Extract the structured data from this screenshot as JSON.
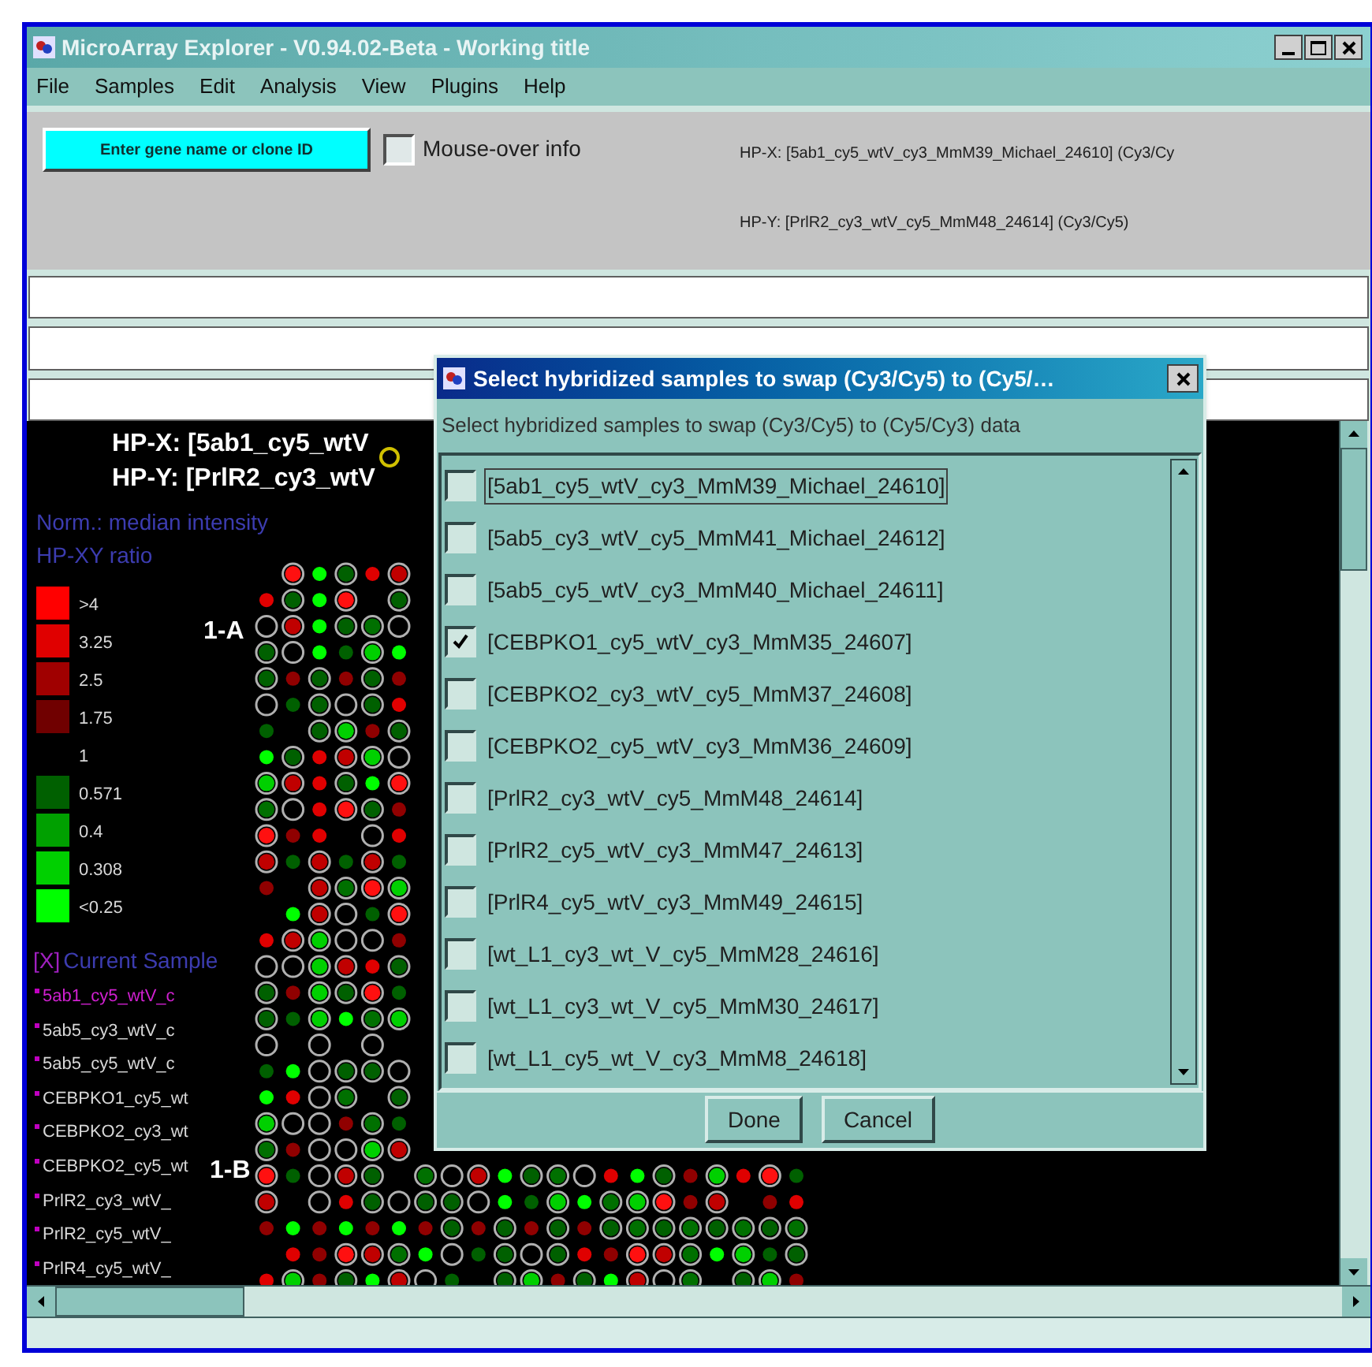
{
  "window": {
    "title": "MicroArray Explorer - V0.94.02-Beta - Working title"
  },
  "menu": [
    "File",
    "Samples",
    "Edit",
    "Analysis",
    "View",
    "Plugins",
    "Help"
  ],
  "toolbar": {
    "search_button": "Enter gene name or clone ID",
    "mouse_over": {
      "label": "Mouse-over info",
      "checked": false
    },
    "hp_x": "HP-X: [5ab1_cy5_wtV_cy3_MmM39_Michael_24610] (Cy3/Cy",
    "hp_y": "HP-Y: [PrlR2_cy3_wtV_cy5_MmM48_24614] (Cy3/Cy5)"
  },
  "canvas": {
    "hp_x": "HP-X: [5ab1_cy5_wtV",
    "hp_y": "HP-Y: [PrlR2_cy3_wtV",
    "norm": "Norm.: median intensity",
    "ratio_label": "HP-XY ratio",
    "legend": [
      {
        "label": ">4",
        "color": "#ff0000"
      },
      {
        "label": "3.25",
        "color": "#e00000"
      },
      {
        "label": "2.5",
        "color": "#a00000"
      },
      {
        "label": "1.75",
        "color": "#700000"
      },
      {
        "label": "1",
        "color": "#000000"
      },
      {
        "label": "0.571",
        "color": "#006000"
      },
      {
        "label": "0.4",
        "color": "#00a000"
      },
      {
        "label": "0.308",
        "color": "#00d000"
      },
      {
        "label": "<0.25",
        "color": "#00ff00"
      }
    ],
    "block_labels": [
      "1-A",
      "1-B"
    ],
    "current_sample": {
      "marker": "[X]",
      "label": "Current Sample"
    },
    "samples": [
      {
        "label": "5ab1_cy5_wtV_c",
        "selected": true
      },
      {
        "label": "5ab5_cy3_wtV_c",
        "selected": false
      },
      {
        "label": "5ab5_cy5_wtV_c",
        "selected": false
      },
      {
        "label": "CEBPKO1_cy5_wt",
        "selected": false
      },
      {
        "label": "CEBPKO2_cy3_wt",
        "selected": false
      },
      {
        "label": "CEBPKO2_cy5_wt",
        "selected": false
      },
      {
        "label": "PrlR2_cy3_wtV_",
        "selected": false
      },
      {
        "label": "PrlR2_cy5_wtV_",
        "selected": false
      },
      {
        "label": "PrlR4_cy5_wtV_",
        "selected": false
      }
    ]
  },
  "dialog": {
    "title": "Select hybridized samples to swap (Cy3/Cy5) to (Cy5/…",
    "prompt": "Select hybridized samples to swap (Cy3/Cy5) to (Cy5/Cy3) data",
    "items": [
      {
        "label": "[5ab1_cy5_wtV_cy3_MmM39_Michael_24610]",
        "checked": false,
        "focused": true
      },
      {
        "label": "[5ab5_cy3_wtV_cy5_MmM41_Michael_24612]",
        "checked": false,
        "focused": false
      },
      {
        "label": "[5ab5_cy5_wtV_cy3_MmM40_Michael_24611]",
        "checked": false,
        "focused": false
      },
      {
        "label": "[CEBPKO1_cy5_wtV_cy3_MmM35_24607]",
        "checked": true,
        "focused": false
      },
      {
        "label": "[CEBPKO2_cy3_wtV_cy5_MmM37_24608]",
        "checked": false,
        "focused": false
      },
      {
        "label": "[CEBPKO2_cy5_wtV_cy3_MmM36_24609]",
        "checked": false,
        "focused": false
      },
      {
        "label": "[PrlR2_cy3_wtV_cy5_MmM48_24614]",
        "checked": false,
        "focused": false
      },
      {
        "label": "[PrlR2_cy5_wtV_cy3_MmM47_24613]",
        "checked": false,
        "focused": false
      },
      {
        "label": "[PrlR4_cy5_wtV_cy3_MmM49_24615]",
        "checked": false,
        "focused": false
      },
      {
        "label": "[wt_L1_cy3_wt_V_cy5_MmM28_24616]",
        "checked": false,
        "focused": false
      },
      {
        "label": "[wt_L1_cy3_wt_V_cy5_MmM30_24617]",
        "checked": false,
        "focused": false
      },
      {
        "label": "[wt_L1_cy5_wt_V_cy3_MmM8_24618]",
        "checked": false,
        "focused": false
      }
    ],
    "buttons": [
      "Done",
      "Cancel"
    ]
  }
}
